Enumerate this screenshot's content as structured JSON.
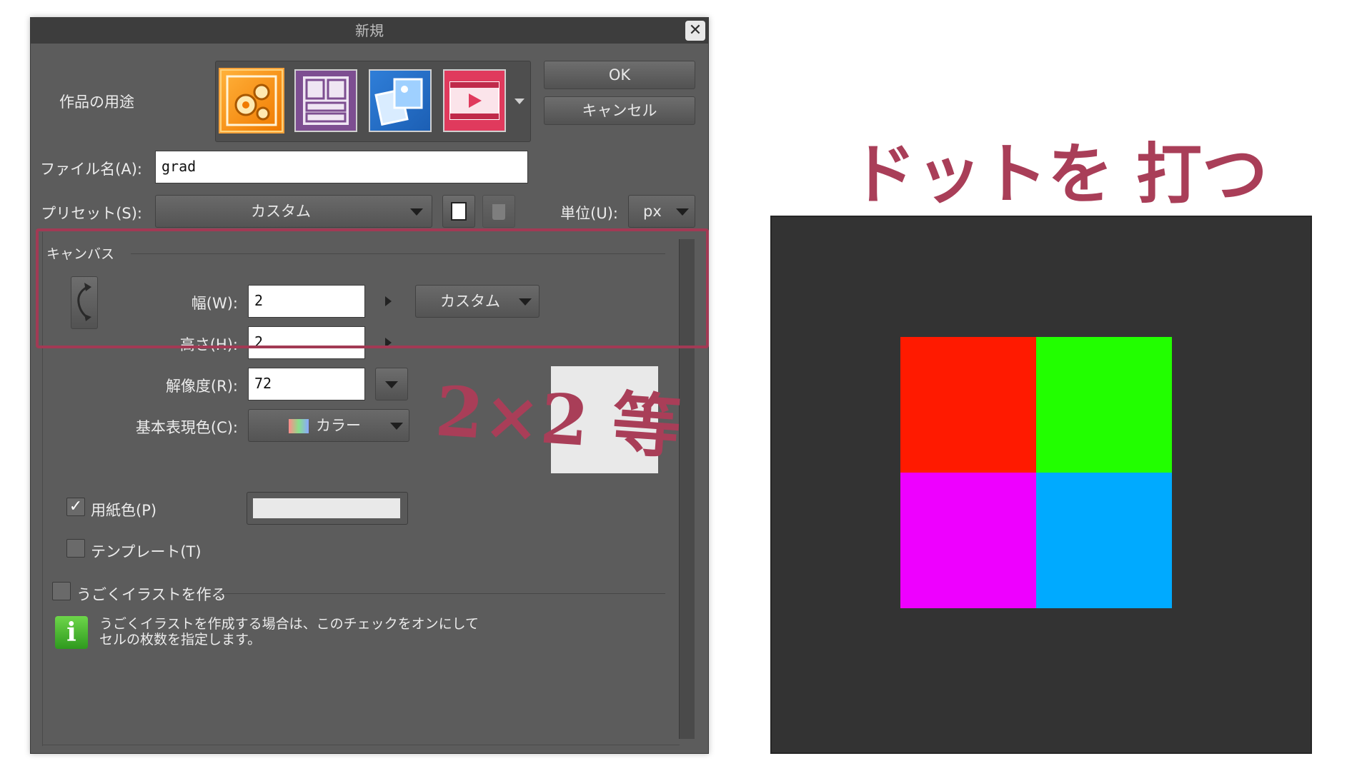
{
  "dialog": {
    "title": "新規",
    "close_label": "✕",
    "usage_label": "作品の用途",
    "usage_icons": [
      "illustration-icon",
      "comic-icon",
      "all-purpose-icon",
      "animation-icon"
    ],
    "ok_label": "OK",
    "cancel_label": "キャンセル",
    "filename_label": "ファイル名(A):",
    "filename_value": "grad",
    "preset_label": "プリセット(S):",
    "preset_value": "カスタム",
    "unit_label": "単位(U):",
    "unit_value": "px",
    "canvas_section": "キャンバス",
    "width_label": "幅(W):",
    "width_value": "2",
    "height_label": "高さ(H):",
    "height_value": "2",
    "size_preset_value": "カスタム",
    "resolution_label": "解像度(R):",
    "resolution_value": "72",
    "color_mode_label": "基本表現色(C):",
    "color_mode_value": "カラー",
    "paper_color_label": "用紙色(P)",
    "paper_color_checked": true,
    "paper_color": "#e9e9e9",
    "template_label": "テンプレート(T)",
    "template_checked": false,
    "animated_label": "うごくイラストを作る",
    "animated_checked": false,
    "info_line1": "うごくイラストを作成する場合は、このチェックをオンにして",
    "info_line2": "セルの枚数を指定します。"
  },
  "annotations": {
    "size_note": "2×2 等",
    "dot_note": "ドットを 打つ"
  },
  "preview": {
    "pixels": [
      {
        "name": "pixel-top-left",
        "color": "#ff1a00"
      },
      {
        "name": "pixel-top-right",
        "color": "#22ff00"
      },
      {
        "name": "pixel-bottom-left",
        "color": "#ee00ff"
      },
      {
        "name": "pixel-bottom-right",
        "color": "#00aaff"
      }
    ]
  },
  "colors": {
    "highlight": "#a23a54",
    "annotation": "#a93e58",
    "dialog_bg": "#5c5c5c"
  }
}
